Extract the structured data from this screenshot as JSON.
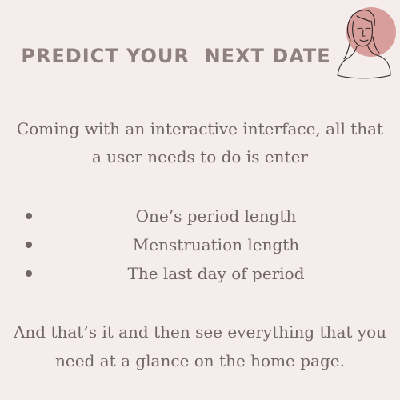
{
  "colors": {
    "background": "#f5ecec",
    "title": "#8e817e",
    "text": "#6f6764",
    "avatar_circle": "#d79e9b"
  },
  "title": "PREDICT YOUR  NEXT DATE",
  "intro": {
    "line1": "Coming with an interactive interface, all that",
    "line2": "a user needs to do is enter"
  },
  "bullets": [
    "One’s period length",
    "Menstruation length",
    "The last day of period"
  ],
  "outro": {
    "line1": "And that’s it and then see everything that you",
    "line2": "need at a glance on the home page."
  },
  "avatar_icon": "woman-line-portrait-icon"
}
